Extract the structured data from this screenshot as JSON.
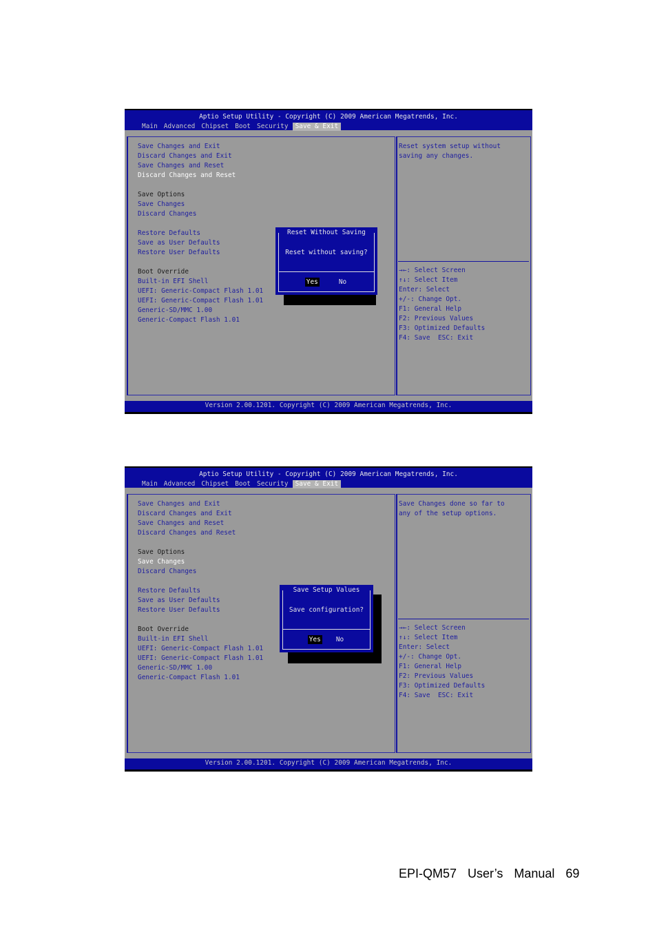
{
  "screens": [
    {
      "title": "Aptio Setup Utility - Copyright (C) 2009 American Megatrends, Inc.",
      "tabs": [
        {
          "label": "Main",
          "active": false
        },
        {
          "label": "Advanced",
          "active": false
        },
        {
          "label": "Chipset",
          "active": false
        },
        {
          "label": "Boot",
          "active": false
        },
        {
          "label": "Security",
          "active": false
        },
        {
          "label": "Save & Exit",
          "active": true
        }
      ],
      "menu": {
        "exit_items": [
          "Save Changes and Exit",
          "Discard Changes and Exit",
          "Save Changes and Reset",
          "Discard Changes and Reset"
        ],
        "save_options_header": "Save Options",
        "save_options_items": [
          "Save Changes",
          "Discard Changes"
        ],
        "defaults_items": [
          "Restore Defaults",
          "Save as User Defaults",
          "Restore User Defaults"
        ],
        "boot_override_header": "Boot Override",
        "boot_override_items": [
          "Built-in EFI Shell",
          "UEFI: Generic-Compact Flash 1.01",
          "UEFI: Generic-Compact Flash 1.01",
          "Generic-SD/MMC 1.00",
          "Generic-Compact Flash 1.01"
        ],
        "selected_item": "Discard Changes and Reset"
      },
      "help_text": [
        "Reset system setup without",
        "saving any changes."
      ],
      "key_help": [
        "→←: Select Screen",
        "↑↓: Select Item",
        "Enter: Select",
        "+/-: Change Opt.",
        "F1: General Help",
        "F2: Previous Values",
        "F3: Optimized Defaults",
        "F4: Save  ESC: Exit"
      ],
      "dialog": {
        "title": "Reset Without Saving",
        "message": "Reset without saving?",
        "buttons": [
          {
            "label": "Yes",
            "focused": true
          },
          {
            "label": "No",
            "focused": false
          }
        ]
      },
      "version": "Version 2.00.1201. Copyright (C) 2009 American Megatrends, Inc."
    },
    {
      "title": "Aptio Setup Utility - Copyright (C) 2009 American Megatrends, Inc.",
      "tabs": [
        {
          "label": "Main",
          "active": false
        },
        {
          "label": "Advanced",
          "active": false
        },
        {
          "label": "Chipset",
          "active": false
        },
        {
          "label": "Boot",
          "active": false
        },
        {
          "label": "Security",
          "active": false
        },
        {
          "label": "Save & Exit",
          "active": true
        }
      ],
      "menu": {
        "exit_items": [
          "Save Changes and Exit",
          "Discard Changes and Exit",
          "Save Changes and Reset",
          "Discard Changes and Reset"
        ],
        "save_options_header": "Save Options",
        "save_options_items": [
          "Save Changes",
          "Discard Changes"
        ],
        "defaults_items": [
          "Restore Defaults",
          "Save as User Defaults",
          "Restore User Defaults"
        ],
        "boot_override_header": "Boot Override",
        "boot_override_items": [
          "Built-in EFI Shell",
          "UEFI: Generic-Compact Flash 1.01",
          "UEFI: Generic-Compact Flash 1.01",
          "Generic-SD/MMC 1.00",
          "Generic-Compact Flash 1.01"
        ],
        "selected_item": "Save Changes"
      },
      "help_text": [
        "Save Changes done so far to",
        "any of the setup options."
      ],
      "key_help": [
        "→←: Select Screen",
        "↑↓: Select Item",
        "Enter: Select",
        "+/-: Change Opt.",
        "F1: General Help",
        "F2: Previous Values",
        "F3: Optimized Defaults",
        "F4: Save  ESC: Exit"
      ],
      "dialog": {
        "title": "Save Setup Values",
        "message": "Save configuration?",
        "buttons": [
          {
            "label": "Yes",
            "focused": true
          },
          {
            "label": "No",
            "focused": false
          }
        ]
      },
      "version": "Version 2.00.1201. Copyright (C) 2009 American Megatrends, Inc."
    }
  ],
  "footer": {
    "text": "EPI-QM57  User’s  Manual  69"
  },
  "colors": {
    "bios_blue": "#0a0a9e",
    "bios_gray": "#9a9a9a",
    "menu_text": "#1d1d9f",
    "selected_text": "#ffffff"
  }
}
